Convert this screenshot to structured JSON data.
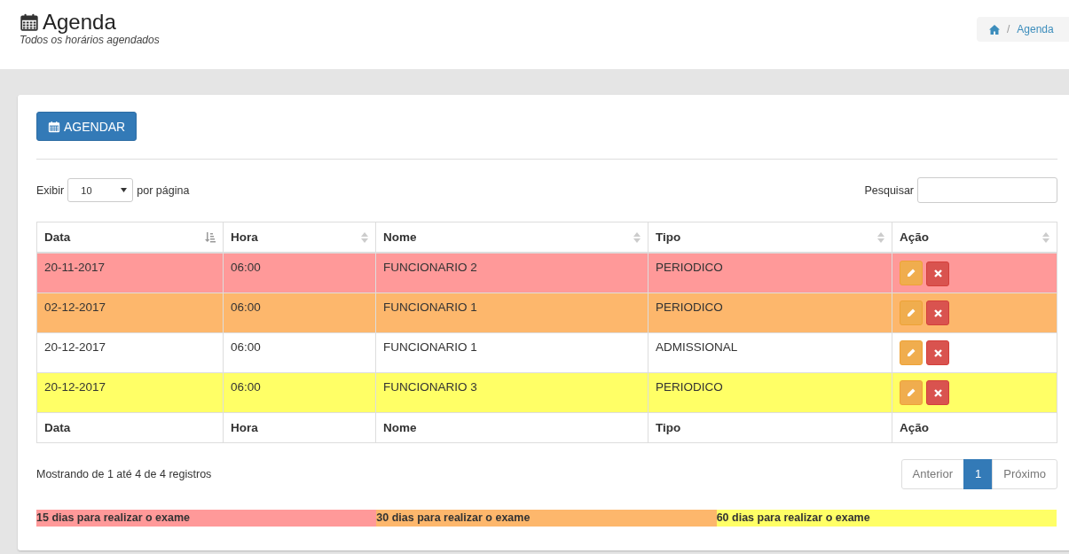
{
  "header": {
    "title": "Agenda",
    "subtitle": "Todos os horários agendados"
  },
  "breadcrumb": {
    "separator": "/",
    "items": [
      "Agenda"
    ]
  },
  "toolbar": {
    "button": "AGENDAR"
  },
  "length_control": {
    "before": "Exibir",
    "value": "10",
    "after": "por página"
  },
  "search": {
    "label": "Pesquisar"
  },
  "table": {
    "columns": [
      {
        "label": "Data",
        "sorted": true
      },
      {
        "label": "Hora",
        "sorted": false
      },
      {
        "label": "Nome",
        "sorted": false
      },
      {
        "label": "Tipo",
        "sorted": false
      },
      {
        "label": "Ação",
        "sorted": false
      }
    ],
    "rows": [
      {
        "color": "#ff9999",
        "cells": [
          "20-11-2017",
          "06:00",
          "FUNCIONARIO 2",
          "PERIODICO"
        ]
      },
      {
        "color": "#fdb76c",
        "cells": [
          "02-12-2017",
          "06:00",
          "FUNCIONARIO 1",
          "PERIODICO"
        ]
      },
      {
        "color": "#ffffff",
        "cells": [
          "20-12-2017",
          "06:00",
          "FUNCIONARIO 1",
          "ADMISSIONAL"
        ]
      },
      {
        "color": "#ffff66",
        "cells": [
          "20-12-2017",
          "06:00",
          "FUNCIONARIO 3",
          "PERIODICO"
        ]
      }
    ],
    "footer": [
      "Data",
      "Hora",
      "Nome",
      "Tipo",
      "Ação"
    ]
  },
  "info": "Mostrando de 1 até 4 de 4 registros",
  "pagination": [
    {
      "label": "Anterior",
      "disabled": true,
      "selected": false
    },
    {
      "label": "1",
      "disabled": false,
      "selected": true
    },
    {
      "label": "Próximo",
      "disabled": true,
      "selected": false
    }
  ],
  "legend": [
    {
      "label": "15 dias para realizar o exame",
      "color": "#ff9999"
    },
    {
      "label": "30 dias para realizar o exame",
      "color": "#fdb76c"
    },
    {
      "label": "60 dias para realizar o exame",
      "color": "#ffff66"
    }
  ]
}
